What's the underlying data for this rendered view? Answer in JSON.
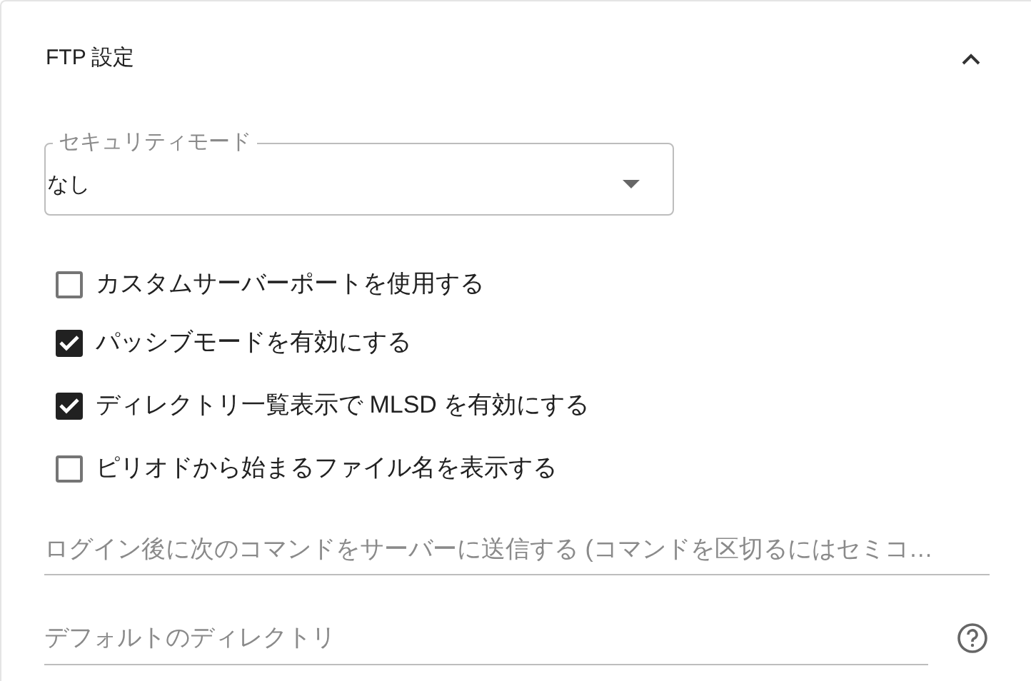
{
  "panel": {
    "title": "FTP 設定",
    "expanded": true
  },
  "security_mode": {
    "label": "セキュリティモード",
    "value": "なし"
  },
  "options": [
    {
      "label": "カスタムサーバーポートを使用する",
      "checked": false
    },
    {
      "label": "パッシブモードを有効にする",
      "checked": true
    },
    {
      "label": "ディレクトリ一覧表示で MLSD を有効にする",
      "checked": true
    },
    {
      "label": "ピリオドから始まるファイル名を表示する",
      "checked": false
    }
  ],
  "commands_field": {
    "placeholder": "ログイン後に次のコマンドをサーバーに送信する (コマンドを区切るにはセミコ…"
  },
  "directory_field": {
    "placeholder": "デフォルトのディレクトリ"
  }
}
